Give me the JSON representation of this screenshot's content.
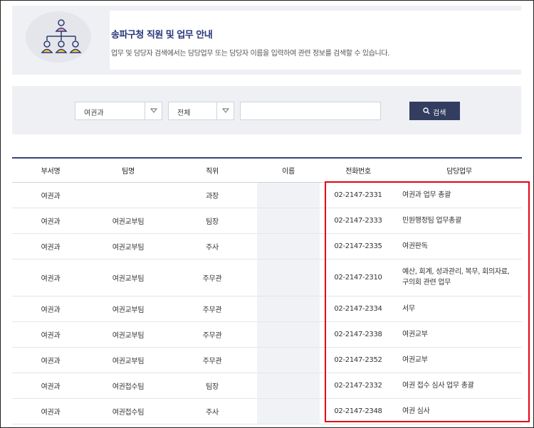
{
  "header": {
    "title": "송파구청 직원 및 업무 안내",
    "subtitle": "업무 및 담당자 검색에서는 담당업무 또는 담당자 이름을 입력하여 관련 정보를 검색할 수 있습니다.",
    "icon": "org-chart-icon"
  },
  "search": {
    "department_select": "여권과",
    "team_select": "전체",
    "keyword_value": "",
    "button_label": "검색"
  },
  "table": {
    "columns": [
      "부서명",
      "팀명",
      "직위",
      "이름",
      "전화번호",
      "담당업무"
    ],
    "rows": [
      {
        "dept": "여권과",
        "team": "",
        "position": "과장",
        "name": "",
        "phone": "02-2147-2331",
        "duty": "여권과 업무 총괄"
      },
      {
        "dept": "여권과",
        "team": "여권교부팀",
        "position": "팀장",
        "name": "",
        "phone": "02-2147-2333",
        "duty": "민원행정팀 업무총괄"
      },
      {
        "dept": "여권과",
        "team": "여권교부팀",
        "position": "주사",
        "name": "",
        "phone": "02-2147-2335",
        "duty": "여권판독"
      },
      {
        "dept": "여권과",
        "team": "여권교부팀",
        "position": "주무관",
        "name": "",
        "phone": "02-2147-2310",
        "duty": "예산, 회계, 성과관리, 복무, 회의자료, 구의회 관련 업무"
      },
      {
        "dept": "여권과",
        "team": "여권교부팀",
        "position": "주무관",
        "name": "",
        "phone": "02-2147-2334",
        "duty": "서무"
      },
      {
        "dept": "여권과",
        "team": "여권교부팀",
        "position": "주무관",
        "name": "",
        "phone": "02-2147-2338",
        "duty": "여권교부"
      },
      {
        "dept": "여권과",
        "team": "여권교부팀",
        "position": "주무관",
        "name": "",
        "phone": "02-2147-2352",
        "duty": "여권교부"
      },
      {
        "dept": "여권과",
        "team": "여권접수팀",
        "position": "팀장",
        "name": "",
        "phone": "02-2147-2332",
        "duty": "여권 접수 심사 업무 총괄"
      },
      {
        "dept": "여권과",
        "team": "여권접수팀",
        "position": "주사",
        "name": "",
        "phone": "02-2147-2348",
        "duty": "여권 심사"
      }
    ]
  },
  "colors": {
    "accent": "#27357a",
    "button": "#333d5f",
    "highlight": "#e60012",
    "panel": "#eef0f4"
  }
}
